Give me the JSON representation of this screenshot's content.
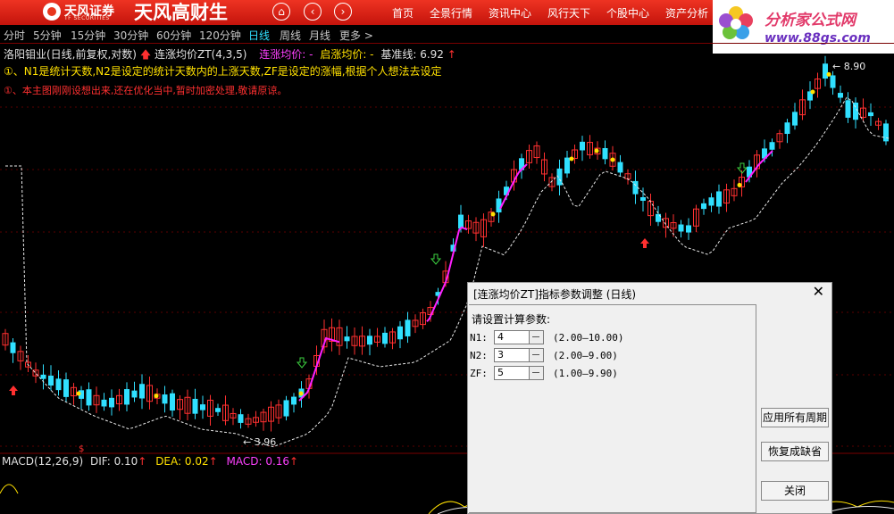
{
  "header": {
    "brand": "天风证券",
    "brand_sub": "TF SECURITIES",
    "slogan": "天风高财生",
    "nav_home": "⌂",
    "nav_back": "‹",
    "nav_forward": "›",
    "menu": [
      "首页",
      "全景行情",
      "资讯中心",
      "风行天下",
      "个股中心",
      "资产分析"
    ]
  },
  "ad": {
    "title": "分析家公式网",
    "url": "www.88gs.com"
  },
  "periods": [
    "分时",
    "5分钟",
    "15分钟",
    "30分钟",
    "60分钟",
    "120分钟",
    "日线",
    "周线",
    "月线",
    "更多 >"
  ],
  "active_period": "日线",
  "info": {
    "stock": "洛阳钼业(日线,前复权,对数)",
    "indicator": "连涨均价ZT(4,3,5)",
    "avg_label": "连涨均价: -",
    "start_label": "启涨均价: -",
    "base_label": "基准线: 6.92",
    "note1": "①、N1是统计天数,N2是设定的统计天数内的上涨天数,ZF是设定的涨幅,根据个人想法去设定",
    "note2": "①、本主图刚刚设想出来,还在优化当中,暂时加密处理,敬请原谅。"
  },
  "chart_labels": {
    "high": "8.90",
    "low": "3.96"
  },
  "macd": {
    "name": "MACD(12,26,9)",
    "dif": "DIF: 0.10",
    "dea": "DEA: 0.02",
    "macd": "MACD: 0.16"
  },
  "dialog": {
    "title": "[连涨均价ZT]指标参数调整 (日线)",
    "close": "✕",
    "prompt": "请设置计算参数:",
    "params": [
      {
        "label": "N1:",
        "value": "4",
        "range": "(2.00—10.00)"
      },
      {
        "label": "N2:",
        "value": "3",
        "range": "(2.00—9.00)"
      },
      {
        "label": "ZF:",
        "value": "5",
        "range": "(1.00—9.90)"
      }
    ],
    "btn_apply": "应用所有周期",
    "btn_restore": "恢复成缺省",
    "btn_close": "关闭"
  },
  "colors": {
    "up": "#ff3030",
    "down": "#30e0ff",
    "accent": "#ff20ff",
    "header": "#e02a18"
  }
}
